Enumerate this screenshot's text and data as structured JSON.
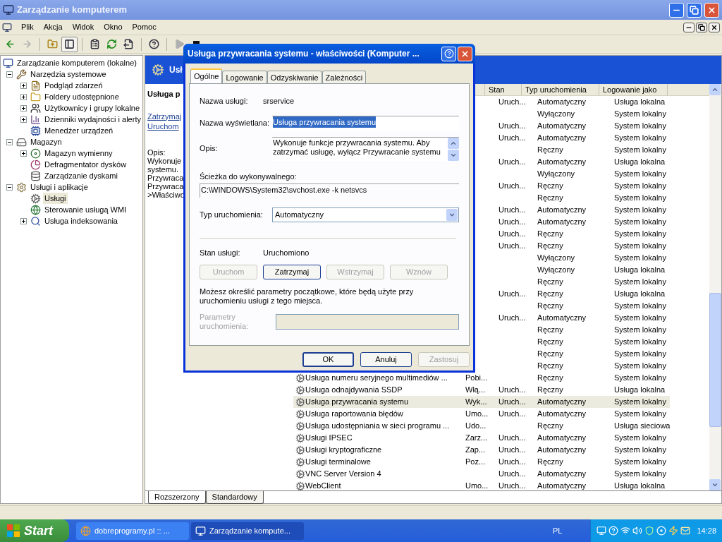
{
  "window": {
    "title": "Zarządzanie komputerem"
  },
  "menu": [
    "Plik",
    "Akcja",
    "Widok",
    "Okno",
    "Pomoc"
  ],
  "toolbar": [
    {
      "kind": "back",
      "disabled": false,
      "pressed": false
    },
    {
      "kind": "forward",
      "disabled": true,
      "pressed": false
    },
    {
      "kind": "separator"
    },
    {
      "kind": "up",
      "disabled": false,
      "pressed": false
    },
    {
      "kind": "tree",
      "disabled": false,
      "pressed": true
    },
    {
      "kind": "separator"
    },
    {
      "kind": "properties",
      "disabled": false,
      "pressed": false
    },
    {
      "kind": "refresh",
      "disabled": false,
      "pressed": false
    },
    {
      "kind": "export",
      "disabled": false,
      "pressed": false
    },
    {
      "kind": "separator"
    },
    {
      "kind": "help",
      "disabled": false,
      "pressed": false
    },
    {
      "kind": "separator"
    },
    {
      "kind": "play",
      "disabled": true,
      "pressed": false
    },
    {
      "kind": "stop",
      "disabled": false,
      "pressed": false
    }
  ],
  "tree": [
    {
      "label": "Zarządzanie komputerem (lokalne)",
      "kind": "computer",
      "selected": false,
      "children": [
        {
          "label": "Narzędzia systemowe",
          "kind": "tools",
          "expanded": true,
          "selected": false,
          "children": [
            {
              "label": "Podgląd zdarzeń",
              "kind": "events",
              "expanded": false,
              "selected": false
            },
            {
              "label": "Foldery udostępnione",
              "kind": "folder",
              "expanded": false,
              "selected": false
            },
            {
              "label": "Użytkownicy i grupy lokalne",
              "kind": "users",
              "expanded": false,
              "selected": false
            },
            {
              "label": "Dzienniki wydajności i alerty",
              "kind": "perf",
              "expanded": false,
              "selected": false
            },
            {
              "label": "Menedżer urządzeń",
              "kind": "device",
              "selected": false
            }
          ]
        },
        {
          "label": "Magazyn",
          "kind": "storage",
          "expanded": true,
          "selected": false,
          "children": [
            {
              "label": "Magazyn wymienny",
              "kind": "removable",
              "expanded": false,
              "selected": false
            },
            {
              "label": "Defragmentator dysków",
              "kind": "defrag",
              "selected": false
            },
            {
              "label": "Zarządzanie dyskami",
              "kind": "disk",
              "selected": false
            }
          ]
        },
        {
          "label": "Usługi i aplikacje",
          "kind": "apps",
          "expanded": true,
          "selected": false,
          "children": [
            {
              "label": "Usługi",
              "kind": "services",
              "selected": true
            },
            {
              "label": "Sterowanie usługą WMI",
              "kind": "wmi",
              "selected": false
            },
            {
              "label": "Usługa indeksowania",
              "kind": "index",
              "expanded": false,
              "selected": false
            }
          ]
        }
      ]
    }
  ],
  "details": {
    "header": "Usł",
    "name": "Usługa p",
    "links": [
      "Zatrzymaj",
      "Uruchom"
    ],
    "lines": [
      "Opis:",
      "Wykonuje",
      "systemu.",
      "Przywraca",
      "Przywraca",
      ">Właściwo"
    ]
  },
  "list": {
    "columns": [
      "Stan",
      "Typ uruchomienia",
      "Logowanie jako"
    ],
    "rows": [
      {
        "status": "Uruch...",
        "startup": "Automatyczny",
        "logon": "Usługa lokalna",
        "selected": false
      },
      {
        "startup": "Wyłączony",
        "logon": "System lokalny",
        "selected": false
      },
      {
        "status": "Uruch...",
        "startup": "Automatyczny",
        "logon": "System lokalny",
        "selected": false
      },
      {
        "status": "Uruch...",
        "startup": "Automatyczny",
        "logon": "System lokalny",
        "selected": false
      },
      {
        "startup": "Ręczny",
        "logon": "System lokalny",
        "selected": false
      },
      {
        "status": "Uruch...",
        "startup": "Automatyczny",
        "logon": "Usługa lokalna",
        "selected": false
      },
      {
        "startup": "Wyłączony",
        "logon": "System lokalny",
        "selected": false
      },
      {
        "status": "Uruch...",
        "startup": "Ręczny",
        "logon": "System lokalny",
        "selected": false
      },
      {
        "startup": "Ręczny",
        "logon": "System lokalny",
        "selected": false
      },
      {
        "status": "Uruch...",
        "startup": "Automatyczny",
        "logon": "System lokalny",
        "selected": false
      },
      {
        "status": "Uruch...",
        "startup": "Automatyczny",
        "logon": "System lokalny",
        "selected": false
      },
      {
        "status": "Uruch...",
        "startup": "Ręczny",
        "logon": "System lokalny",
        "selected": false
      },
      {
        "status": "Uruch...",
        "startup": "Ręczny",
        "logon": "System lokalny",
        "selected": false
      },
      {
        "startup": "Wyłączony",
        "logon": "System lokalny",
        "selected": false
      },
      {
        "startup": "Wyłączony",
        "logon": "Usługa lokalna",
        "selected": false
      },
      {
        "startup": "Ręczny",
        "logon": "System lokalny",
        "selected": false
      },
      {
        "status": "Uruch...",
        "startup": "Ręczny",
        "logon": "Usługa lokalna",
        "selected": false
      },
      {
        "startup": "Ręczny",
        "logon": "System lokalny",
        "selected": false
      },
      {
        "status": "Uruch...",
        "startup": "Automatyczny",
        "logon": "System lokalny",
        "selected": false
      },
      {
        "startup": "Ręczny",
        "logon": "System lokalny",
        "selected": false
      },
      {
        "startup": "Ręczny",
        "logon": "System lokalny",
        "selected": false
      },
      {
        "startup": "Ręczny",
        "logon": "System lokalny",
        "selected": false
      },
      {
        "startup": "Ręczny",
        "logon": "System lokalny",
        "selected": false
      },
      {
        "name": "Usługa numeru seryjnego multimediów ...",
        "description": "Pobi...",
        "startup": "Ręczny",
        "logon": "System lokalny",
        "selected": false
      },
      {
        "name": "Usługa odnajdywania SSDP",
        "description": "Włą...",
        "status": "Uruch...",
        "startup": "Ręczny",
        "logon": "Usługa lokalna",
        "selected": false
      },
      {
        "name": "Usługa przywracania systemu",
        "description": "Wyk...",
        "status": "Uruch...",
        "startup": "Automatyczny",
        "logon": "System lokalny",
        "selected": true
      },
      {
        "name": "Usługa raportowania błędów",
        "description": "Umo...",
        "status": "Uruch...",
        "startup": "Automatyczny",
        "logon": "System lokalny",
        "selected": false
      },
      {
        "name": "Usługa udostępniania w sieci programu ...",
        "description": "Udo...",
        "startup": "Ręczny",
        "logon": "Usługa sieciowa",
        "selected": false
      },
      {
        "name": "Usługi IPSEC",
        "description": "Zarz...",
        "status": "Uruch...",
        "startup": "Automatyczny",
        "logon": "System lokalny",
        "selected": false
      },
      {
        "name": "Usługi kryptograficzne",
        "description": "Zap...",
        "status": "Uruch...",
        "startup": "Automatyczny",
        "logon": "System lokalny",
        "selected": false
      },
      {
        "name": "Usługi terminalowe",
        "description": "Poz...",
        "status": "Uruch...",
        "startup": "Ręczny",
        "logon": "System lokalny",
        "selected": false
      },
      {
        "name": "VNC Server Version 4",
        "status": "Uruch...",
        "startup": "Automatyczny",
        "logon": "System lokalny",
        "selected": false
      },
      {
        "name": "WebClient",
        "description": "Umo...",
        "status": "Uruch...",
        "startup": "Automatyczny",
        "logon": "Usługa lokalna",
        "selected": false
      }
    ]
  },
  "view_tabs": [
    {
      "label": "Rozszerzony",
      "selected": true
    },
    {
      "label": "Standardowy",
      "selected": false
    }
  ],
  "dialog": {
    "title": "Usługa przywracania systemu - właściwości (Komputer ...",
    "tabs": [
      {
        "label": "Ogólne",
        "selected": true
      },
      {
        "label": "Logowanie",
        "selected": false
      },
      {
        "label": "Odzyskiwanie",
        "selected": false
      },
      {
        "label": "Zależności",
        "selected": false
      }
    ],
    "service_name_label": "Nazwa usługi:",
    "service_name": "srservice",
    "display_name_label": "Nazwa wyświetlana:",
    "display_name": "Usługa przywracania systemu",
    "display_name_selected": true,
    "description_label": "Opis:",
    "description": "Wykonuje funkcje przywracania systemu. Aby zatrzymać usługę, wyłącz Przywracanie systemu",
    "path_label": "Ścieżka do wykonywalnego:",
    "path": "C:\\WINDOWS\\System32\\svchost.exe -k netsvcs",
    "startup_label": "Typ uruchomienia:",
    "startup": "Automatyczny",
    "status_label": "Stan usługi:",
    "status": "Uruchomiono",
    "service_buttons": [
      {
        "label": "Uruchom",
        "disabled": true
      },
      {
        "label": "Zatrzymaj",
        "disabled": false
      },
      {
        "label": "Wstrzymaj",
        "disabled": true
      },
      {
        "label": "Wznów",
        "disabled": true
      }
    ],
    "hint": "Możesz określić parametry początkowe, które będą użyte przy uruchomieniu usługi z tego miejsca.",
    "params_label": "Parametry uruchomienia:",
    "params_disabled": true,
    "buttons": [
      {
        "label": "OK",
        "disabled": false,
        "default": true
      },
      {
        "label": "Anuluj",
        "disabled": false,
        "default": false
      },
      {
        "label": "Zastosuj",
        "disabled": true,
        "default": false
      }
    ]
  },
  "taskbar": {
    "start": "Start",
    "tasks": [
      {
        "label": "dobreprogramy.pl :: ...",
        "kind": "browser",
        "selected": false
      },
      {
        "label": "Zarządzanie kompute...",
        "kind": "computer",
        "selected": true
      }
    ],
    "language": "PL",
    "clock": "14:28"
  }
}
